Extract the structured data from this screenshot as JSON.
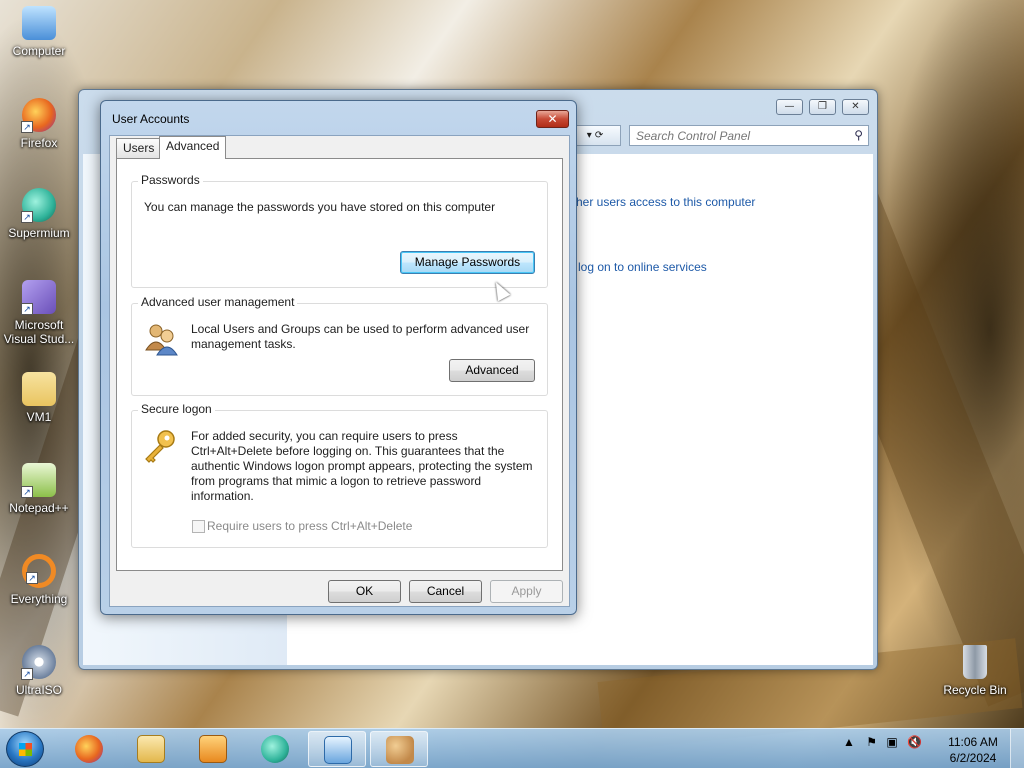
{
  "desktop": {
    "icons": [
      {
        "label": "Computer",
        "icon": "computer-icon",
        "color": "#4a8fd8"
      },
      {
        "label": "Firefox",
        "icon": "firefox-icon",
        "color": "#e8671f"
      },
      {
        "label": "Supermium",
        "icon": "supermium-icon",
        "color": "#2fb39a"
      },
      {
        "label": "Microsoft Visual Stud...",
        "icon": "visual-studio-icon",
        "color": "#6a4fb8"
      },
      {
        "label": "VM1",
        "icon": "folder-icon",
        "color": "#e9c460"
      },
      {
        "label": "Notepad++",
        "icon": "notepad-plus-plus-icon",
        "color": "#8cc04a"
      },
      {
        "label": "Everything",
        "icon": "everything-search-icon",
        "color": "#f08a24"
      },
      {
        "label": "UltraISO",
        "icon": "ultraiso-disc-icon",
        "color": "#b8c4d4"
      }
    ],
    "recycle_bin": {
      "label": "Recycle Bin",
      "icon": "recycle-bin-icon"
    }
  },
  "control_panel": {
    "search_placeholder": "Search Control Panel",
    "link_access": "her users access to this computer",
    "link_online": "log on to online services"
  },
  "dialog": {
    "title": "User Accounts",
    "close_label": "✕",
    "tabs": [
      "Users",
      "Advanced"
    ],
    "active_tab": "Advanced",
    "passwords": {
      "label": "Passwords",
      "text": "You can manage the passwords you have stored on this computer",
      "button": "Manage Passwords"
    },
    "advanced_management": {
      "label": "Advanced user management",
      "text": "Local Users and Groups can be used to perform advanced user management tasks.",
      "button": "Advanced"
    },
    "secure_logon": {
      "label": "Secure logon",
      "text": "For added security, you can require users to press Ctrl+Alt+Delete before logging on. This guarantees that the authentic Windows logon prompt appears, protecting the system from programs that mimic a logon to retrieve password information.",
      "checkbox_label": "Require users to press Ctrl+Alt+Delete",
      "checkbox_checked": false,
      "checkbox_enabled": false
    },
    "buttons": {
      "ok": "OK",
      "cancel": "Cancel",
      "apply": "Apply"
    }
  },
  "taskbar": {
    "items": [
      {
        "name": "firefox",
        "icon": "firefox-icon",
        "running": false
      },
      {
        "name": "file-explorer",
        "icon": "file-explorer-icon",
        "running": false
      },
      {
        "name": "media-player",
        "icon": "media-player-icon",
        "running": false
      },
      {
        "name": "supermium",
        "icon": "supermium-icon",
        "running": false
      },
      {
        "name": "control-panel",
        "icon": "control-panel-icon",
        "running": true
      },
      {
        "name": "user-accounts",
        "icon": "user-accounts-icon",
        "running": true
      }
    ],
    "time": "11:06 AM",
    "date": "6/2/2024"
  }
}
